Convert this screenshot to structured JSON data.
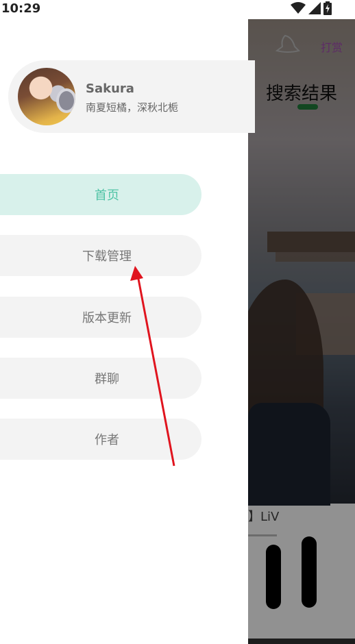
{
  "status_bar": {
    "time": "10:29",
    "icons": [
      "wifi-icon",
      "signal-icon",
      "battery-charging-icon"
    ]
  },
  "drawer": {
    "user": {
      "name": "Sakura",
      "motto": "南夏短橘，深秋北栀"
    },
    "menu": [
      {
        "label": "首页",
        "active": true
      },
      {
        "label": "下载管理",
        "active": false
      },
      {
        "label": "版本更新",
        "active": false
      },
      {
        "label": "群聊",
        "active": false
      },
      {
        "label": "作者",
        "active": false
      }
    ]
  },
  "background_app": {
    "title": "搜索结果",
    "tab_label": "打赏",
    "song_label": "】LiV"
  },
  "colors": {
    "active_bg": "#d8f1eb",
    "active_text": "#4fc3a5",
    "inactive_bg": "#f3f3f3",
    "annotation_arrow": "#e0141e"
  }
}
